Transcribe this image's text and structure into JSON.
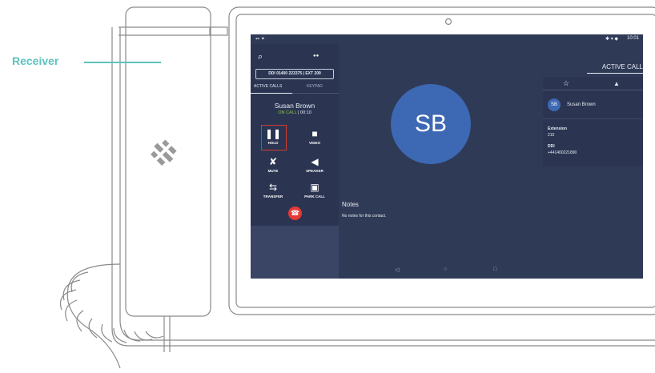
{
  "annotation": {
    "label": "Receiver",
    "color": "#5cc2c0"
  },
  "status_bar": {
    "left_icons": "↭ ✦",
    "time": "10:01",
    "right_icons": "✱ ▾ ◆"
  },
  "left_panel": {
    "search_icon": "⌕",
    "contacts_icon": "●●",
    "ddi_text": "DDI 01400 223375 | EXT 209",
    "tabs": [
      {
        "label": "ACTIVE CALLS"
      },
      {
        "label": "KEYPAD"
      }
    ],
    "caller_name": "Susan Brown",
    "call_status": "ON CALL",
    "call_separator": " | ",
    "call_time": "00:10",
    "controls": [
      {
        "label": "HOLD",
        "icon": "❚❚"
      },
      {
        "label": "VIDEO",
        "icon": "■"
      },
      {
        "label": "MUTE",
        "icon": "✘"
      },
      {
        "label": "SPEAKER",
        "icon": "◀"
      },
      {
        "label": "TRANSFER",
        "icon": "⇆"
      },
      {
        "label": "PARK CALL",
        "icon": "▣"
      }
    ],
    "end_call_icon": "☎"
  },
  "main": {
    "avatar_initials": "SB",
    "notes_title": "Notes",
    "notes_text": "No notes for this contact."
  },
  "right_panel": {
    "header": "ACTIVE CALL",
    "star_icon": "☆",
    "person_icon": "▲",
    "contact_initials": "SB",
    "contact_name": "Susan Brown",
    "extension_label": "Extension",
    "extension_value": "210",
    "ddi_label": "DDI",
    "ddi_value": "+441400221890"
  },
  "nav": {
    "back": "◁",
    "home": "○",
    "recent": "□"
  },
  "colors": {
    "screen_bg": "#2f3a56",
    "panel_bg": "#2b3552",
    "avatar": "#3d68b3",
    "end_call": "#e53935",
    "on_call": "#8bc34a",
    "hold_highlight": "#d33a2f"
  }
}
